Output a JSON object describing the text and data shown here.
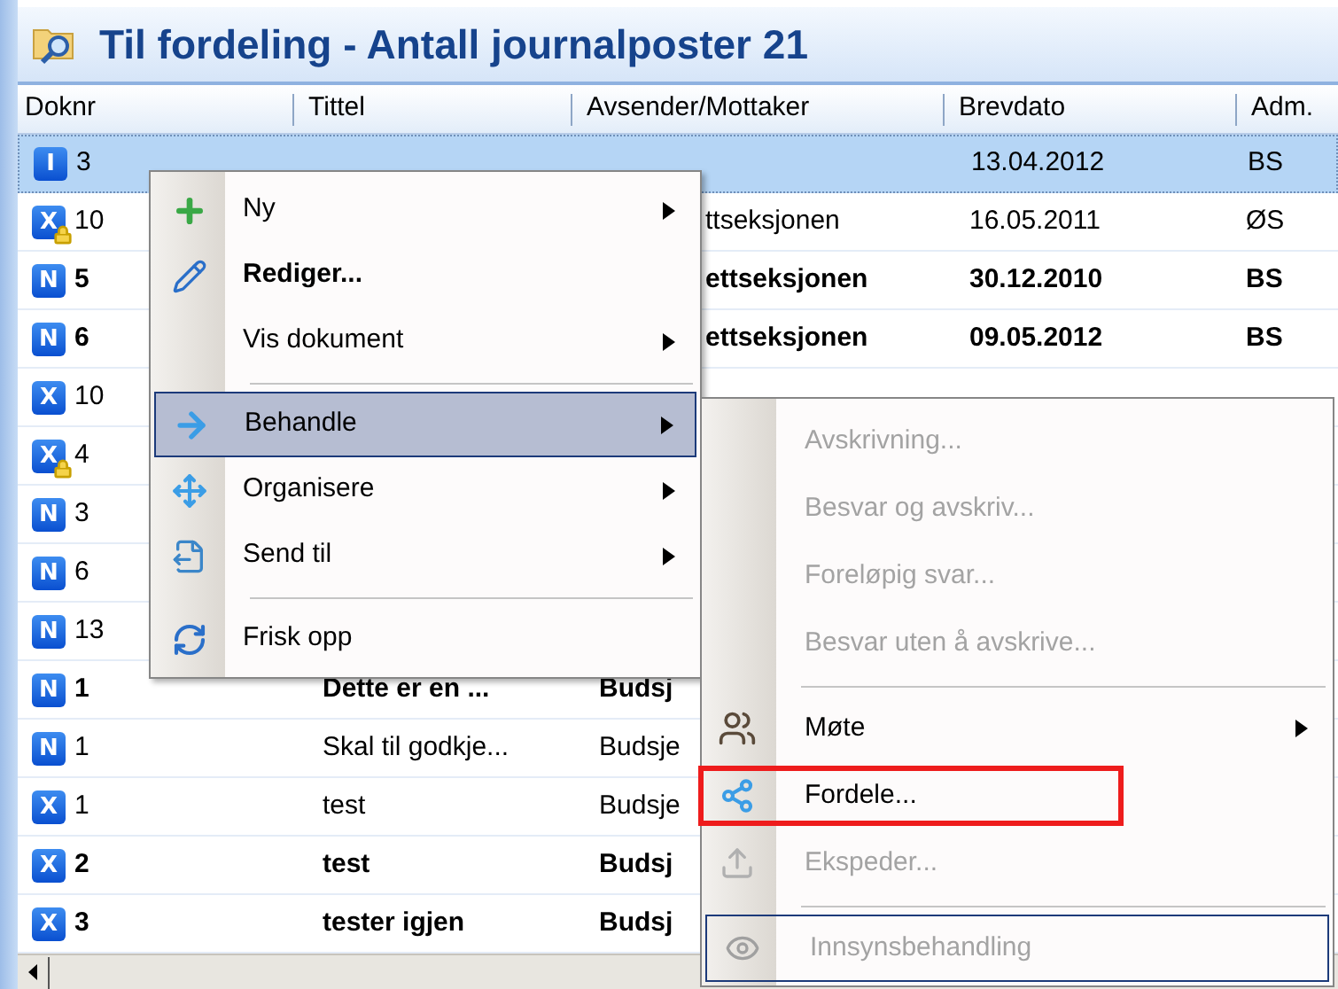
{
  "title": "Til fordeling - Antall journalposter 21",
  "columns": [
    "Doknr",
    "Tittel",
    "Avsender/Mottaker",
    "Brevdato",
    "Adm."
  ],
  "rows": [
    {
      "type": "I",
      "locked": false,
      "bold": false,
      "selected": true,
      "doknr": "3",
      "date": "13.04.2012",
      "adm": "BS"
    },
    {
      "type": "X",
      "locked": true,
      "bold": false,
      "selected": false,
      "doknr": "10",
      "sender": "ttseksjonen",
      "sender_clipped": true,
      "date": "16.05.2011",
      "adm": "ØS"
    },
    {
      "type": "N",
      "locked": false,
      "bold": true,
      "selected": false,
      "doknr": "5",
      "sender": "ettseksjonen",
      "sender_clipped": true,
      "date": "30.12.2010",
      "adm": "BS"
    },
    {
      "type": "N",
      "locked": false,
      "bold": true,
      "selected": false,
      "doknr": "6",
      "sender": "ettseksjonen",
      "sender_clipped": true,
      "date": "09.05.2012",
      "adm": "BS"
    },
    {
      "type": "X",
      "locked": false,
      "bold": false,
      "selected": false,
      "doknr": "10"
    },
    {
      "type": "X",
      "locked": true,
      "bold": false,
      "selected": false,
      "doknr": "4"
    },
    {
      "type": "N",
      "locked": false,
      "bold": false,
      "selected": false,
      "doknr": "3"
    },
    {
      "type": "N",
      "locked": false,
      "bold": false,
      "selected": false,
      "doknr": "6"
    },
    {
      "type": "N",
      "locked": false,
      "bold": false,
      "selected": false,
      "doknr": "13"
    },
    {
      "type": "N",
      "locked": false,
      "bold": true,
      "selected": false,
      "doknr": "1",
      "title": "Dette er en ...",
      "sender": "Budsj"
    },
    {
      "type": "N",
      "locked": false,
      "bold": false,
      "selected": false,
      "doknr": "1",
      "title": "Skal til godkje...",
      "sender": "Budsje"
    },
    {
      "type": "X",
      "locked": false,
      "bold": false,
      "selected": false,
      "doknr": "1",
      "title": "test",
      "sender": "Budsje"
    },
    {
      "type": "X",
      "locked": false,
      "bold": true,
      "selected": false,
      "doknr": "2",
      "title": "test",
      "sender": "Budsj"
    },
    {
      "type": "X",
      "locked": false,
      "bold": true,
      "selected": false,
      "doknr": "3",
      "title": "tester igjen",
      "sender": "Budsj"
    }
  ],
  "context_menu": [
    {
      "kind": "item",
      "label": "Ny",
      "bold": false,
      "submenu": true,
      "selected": false
    },
    {
      "kind": "item",
      "label": "Rediger...",
      "bold": true,
      "submenu": false,
      "selected": false
    },
    {
      "kind": "item",
      "label": "Vis dokument",
      "bold": false,
      "submenu": true,
      "selected": false
    },
    {
      "kind": "separator"
    },
    {
      "kind": "item",
      "label": "Behandle",
      "bold": false,
      "submenu": true,
      "selected": true
    },
    {
      "kind": "item",
      "label": "Organisere",
      "bold": false,
      "submenu": true,
      "selected": false
    },
    {
      "kind": "item",
      "label": "Send til",
      "bold": false,
      "submenu": true,
      "selected": false
    },
    {
      "kind": "separator"
    },
    {
      "kind": "item",
      "label": "Frisk opp",
      "bold": false,
      "submenu": false,
      "selected": false
    }
  ],
  "submenu": [
    {
      "kind": "item",
      "label": "Avskrivning...",
      "disabled": true,
      "submenu": false,
      "outlined": false,
      "focused": false
    },
    {
      "kind": "item",
      "label": "Besvar og avskriv...",
      "disabled": true,
      "submenu": false,
      "outlined": false,
      "focused": false
    },
    {
      "kind": "item",
      "label": "Foreløpig svar...",
      "disabled": true,
      "submenu": false,
      "outlined": false,
      "focused": false
    },
    {
      "kind": "item",
      "label": "Besvar uten å avskrive...",
      "disabled": true,
      "submenu": false,
      "outlined": false,
      "focused": false
    },
    {
      "kind": "separator"
    },
    {
      "kind": "item",
      "label": "Møte",
      "disabled": false,
      "submenu": true,
      "outlined": false,
      "focused": false
    },
    {
      "kind": "item",
      "label": "Fordele...",
      "disabled": false,
      "submenu": false,
      "outlined": true,
      "focused": false
    },
    {
      "kind": "item",
      "label": "Ekspeder...",
      "disabled": true,
      "submenu": false,
      "outlined": false,
      "focused": false
    },
    {
      "kind": "separator"
    },
    {
      "kind": "item",
      "label": "Innsynsbehandling",
      "disabled": true,
      "submenu": false,
      "outlined": false,
      "focused": true
    }
  ]
}
